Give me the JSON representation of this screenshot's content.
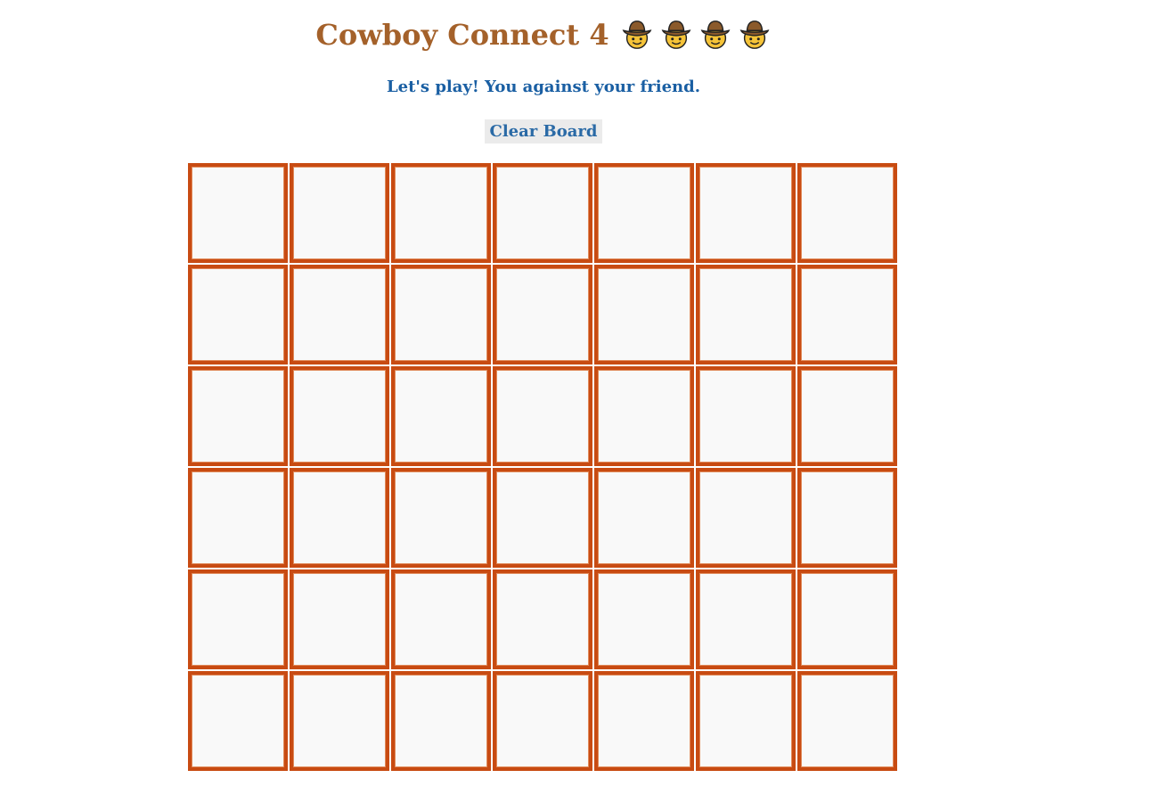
{
  "game": {
    "title": "Cowboy Connect 4",
    "title_emojis": [
      "cowboy-face-icon",
      "cowboy-face-icon",
      "cowboy-face-icon",
      "cowboy-face-icon"
    ],
    "subtitle": "Let's play! You against your friend.",
    "clear_button_label": "Clear Board"
  },
  "board": {
    "rows": 6,
    "columns": 7,
    "cells": [
      [
        "",
        "",
        "",
        "",
        "",
        "",
        ""
      ],
      [
        "",
        "",
        "",
        "",
        "",
        "",
        ""
      ],
      [
        "",
        "",
        "",
        "",
        "",
        "",
        ""
      ],
      [
        "",
        "",
        "",
        "",
        "",
        "",
        ""
      ],
      [
        "",
        "",
        "",
        "",
        "",
        "",
        ""
      ],
      [
        "",
        "",
        "",
        "",
        "",
        "",
        ""
      ]
    ]
  },
  "colors": {
    "title": "#a4612a",
    "subtitle": "#1a5fa3",
    "cell_border": "#c84b12",
    "cell_background": "#f9f9f9",
    "button_background": "#ebebeb"
  }
}
